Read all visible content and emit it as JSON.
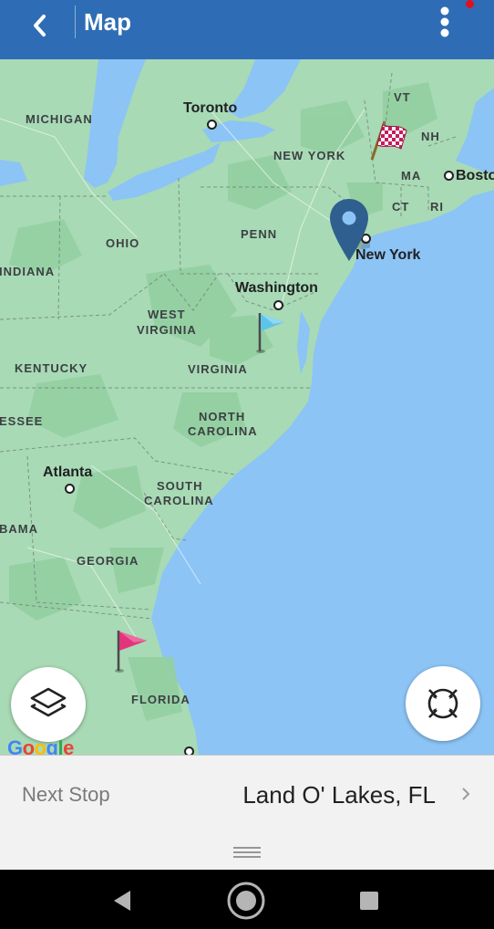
{
  "appbar": {
    "title": "Map",
    "icons": {
      "back": "back-arrow-icon",
      "menu": "more-vertical-icon"
    },
    "notification_dot_color": "#e0111b",
    "bar_color": "#2e6db5"
  },
  "map": {
    "cities": [
      {
        "name": "Toronto"
      },
      {
        "name": "Washington"
      },
      {
        "name": "Atlanta"
      },
      {
        "name": "New York"
      },
      {
        "name": "Boston"
      }
    ],
    "states": {
      "michigan": "MICHIGAN",
      "ohio": "OHIO",
      "indiana": "INDIANA",
      "west_virginia_1": "WEST",
      "west_virginia_2": "VIRGINIA",
      "virginia": "VIRGINIA",
      "kentucky": "KENTUCKY",
      "tennessee": "ESSEE",
      "north_carolina_1": "NORTH",
      "north_carolina_2": "CAROLINA",
      "south_carolina_1": "SOUTH",
      "south_carolina_2": "CAROLINA",
      "georgia": "GEORGIA",
      "alabama": "BAMA",
      "florida": "FLORIDA",
      "penn": "PENN",
      "new_york": "NEW YORK",
      "vt": "VT",
      "nh": "NH",
      "ma": "MA",
      "ct": "CT",
      "ri": "RI"
    },
    "markers": [
      {
        "name": "finish-flag",
        "icon": "checkered-flag-icon"
      },
      {
        "name": "current-location",
        "icon": "location-pin-icon",
        "color": "#2f5f8f"
      },
      {
        "name": "waypoint",
        "icon": "blue-flag-icon",
        "color": "#5ec3e8"
      },
      {
        "name": "start",
        "icon": "pink-flag-icon",
        "color": "#e2347a"
      }
    ],
    "land_color": "#a8dab5",
    "water_color": "#8cc4f5",
    "google_logo": "Google",
    "layers_button_icon": "layers-icon",
    "recenter_button_icon": "recenter-icon"
  },
  "next_stop": {
    "label": "Next Stop",
    "value": "Land O' Lakes, FL",
    "icon": "chevron-right-icon"
  },
  "drawer_handle_icon": "drag-handle-icon",
  "system_nav": {
    "back_icon": "nav-back-icon",
    "home_icon": "nav-home-icon",
    "recents_icon": "nav-recents-icon"
  }
}
